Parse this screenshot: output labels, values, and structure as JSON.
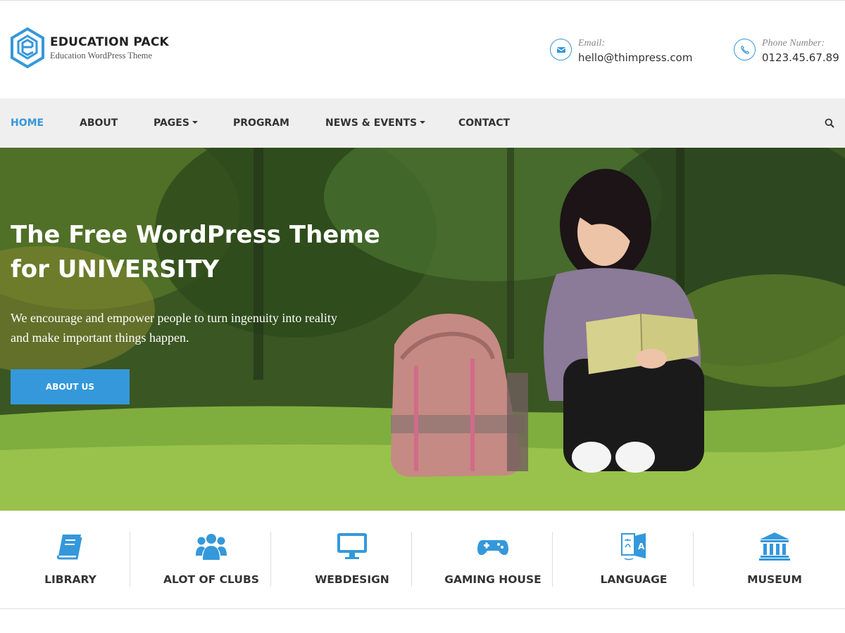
{
  "brand": {
    "name": "EDUCATION PACK",
    "tagline": "Education WordPress Theme",
    "logo_icon": "hexagon-e-logo-icon",
    "accent_color": "#3498db"
  },
  "contact": {
    "email": {
      "label": "Email:",
      "value": "hello@thimpress.com",
      "icon": "envelope-icon"
    },
    "phone": {
      "label": "Phone Number:",
      "value": "0123.45.67.89",
      "icon": "phone-icon"
    }
  },
  "nav": {
    "items": [
      {
        "label": "HOME",
        "active": true,
        "dropdown": false
      },
      {
        "label": "ABOUT",
        "active": false,
        "dropdown": false
      },
      {
        "label": "PAGES",
        "active": false,
        "dropdown": true
      },
      {
        "label": "PROGRAM",
        "active": false,
        "dropdown": false
      },
      {
        "label": "NEWS & EVENTS",
        "active": false,
        "dropdown": true
      },
      {
        "label": "CONTACT",
        "active": false,
        "dropdown": false
      }
    ],
    "search_icon": "search-icon"
  },
  "hero": {
    "title_line1": "The Free WordPress Theme",
    "title_line2": "for UNIVERSITY",
    "description_line1": "We encourage and empower people to turn ingenuity into reality",
    "description_line2": "and make important things happen.",
    "button_label": "ABOUT US"
  },
  "features": [
    {
      "label": "LIBRARY",
      "icon": "book-icon"
    },
    {
      "label": "ALOT OF CLUBS",
      "icon": "users-icon"
    },
    {
      "label": "WEBDESIGN",
      "icon": "desktop-icon"
    },
    {
      "label": "GAMING HOUSE",
      "icon": "gamepad-icon"
    },
    {
      "label": "LANGUAGE",
      "icon": "translate-icon"
    },
    {
      "label": "MUSEUM",
      "icon": "museum-icon"
    }
  ]
}
